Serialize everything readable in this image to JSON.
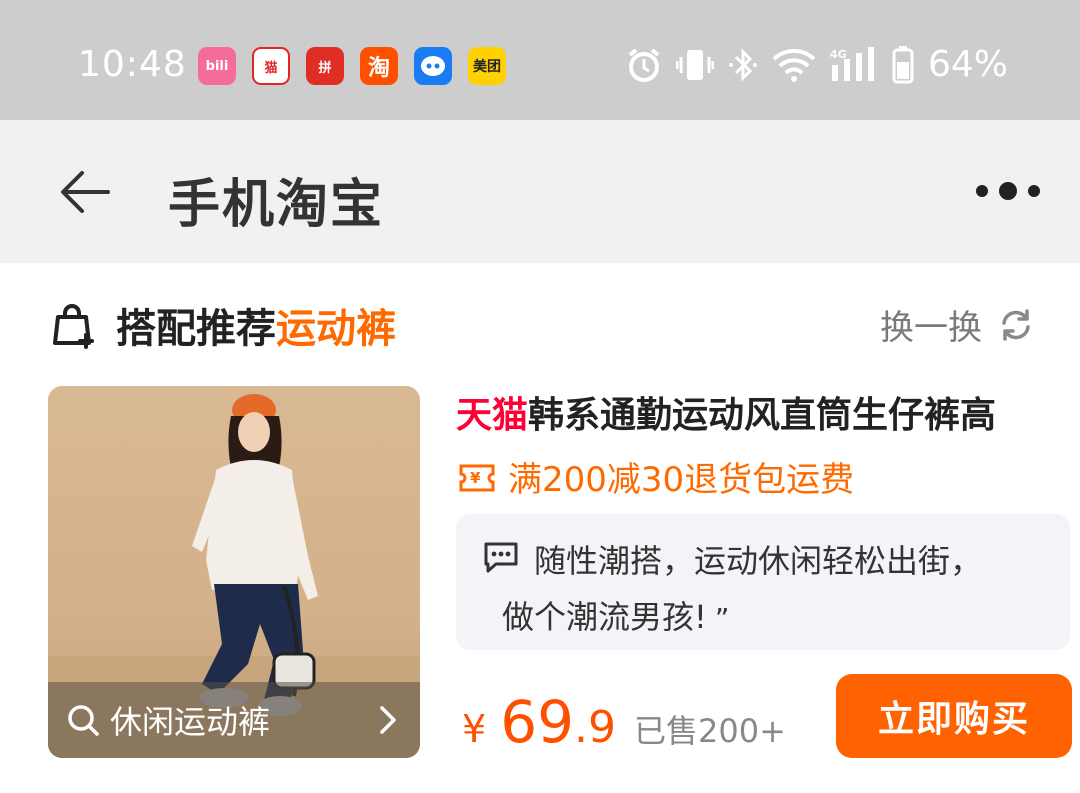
{
  "status_bar": {
    "time": "10:48",
    "battery": "64%",
    "network": "4G",
    "apps": [
      {
        "name": "bilibili-icon",
        "label": "bili",
        "color": "#f36c9a"
      },
      {
        "name": "tmall-icon",
        "label": "猫",
        "color": "#e12626"
      },
      {
        "name": "pinduoduo-icon",
        "label": "拼",
        "color": "#e02e24"
      },
      {
        "name": "taobao-icon",
        "label": "淘",
        "color": "#ff5000"
      },
      {
        "name": "bot-icon",
        "label": "",
        "color": "#1a7cf2"
      },
      {
        "name": "meituan-icon",
        "label": "美团",
        "color": "#ffd100"
      }
    ]
  },
  "header": {
    "title": "手机淘宝"
  },
  "section": {
    "title": "搭配推荐",
    "accent": "运动裤",
    "refresh_label": "换一换"
  },
  "product": {
    "image_search_label": "休闲运动裤",
    "title_tag": "天猫",
    "title": "韩系通勤运动风直筒生仔裤高",
    "promo": "满200减30退货包运费",
    "review_line1": "随性潮搭，运动休闲轻松出街，",
    "review_line2": "做个潮流男孩!",
    "currency": "¥",
    "price_int": "69",
    "price_dec": ".9",
    "sold": "已售200+",
    "buy_label": "立即购买"
  },
  "colors": {
    "accent": "#ff6a00",
    "tmall": "#ff0036",
    "buy_button": "#ff6200"
  }
}
